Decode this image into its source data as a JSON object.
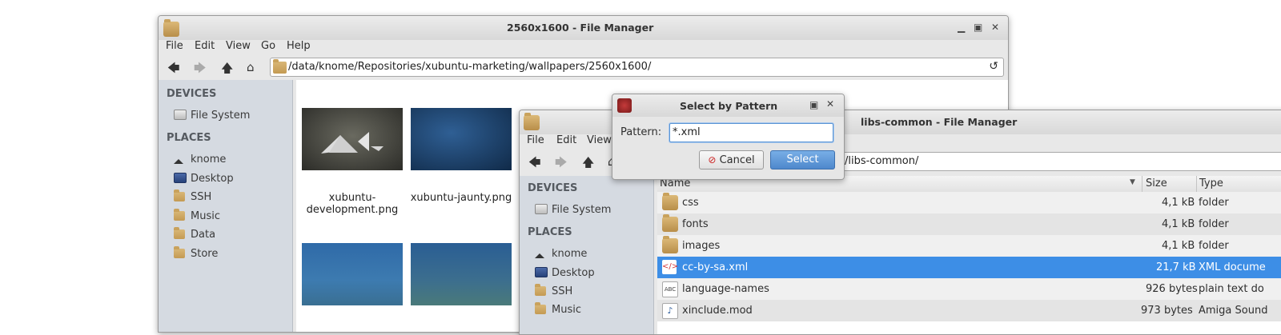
{
  "win1": {
    "title": "2560x1600 - File Manager",
    "menu": [
      "File",
      "Edit",
      "View",
      "Go",
      "Help"
    ],
    "path": "/data/knome/Repositories/xubuntu-marketing/wallpapers/2560x1600/",
    "sidebar": {
      "devices_heading": "DEVICES",
      "devices": [
        {
          "label": "File System",
          "icon": "drive-icon"
        }
      ],
      "places_heading": "PLACES",
      "places": [
        {
          "label": "knome",
          "icon": "home-icon"
        },
        {
          "label": "Desktop",
          "icon": "desktop-icon"
        },
        {
          "label": "SSH",
          "icon": "folder-icon"
        },
        {
          "label": "Music",
          "icon": "folder-icon"
        },
        {
          "label": "Data",
          "icon": "folder-icon"
        },
        {
          "label": "Store",
          "icon": "folder-icon"
        }
      ]
    },
    "files": [
      {
        "line1": "xubuntu-",
        "line2": "development.png"
      },
      {
        "line1": "xubuntu-jaunty.png",
        "line2": ""
      }
    ]
  },
  "win2": {
    "title": "libs-common - File Manager",
    "menu": [
      "File",
      "Edit",
      "View"
    ],
    "path": "/libs-common/",
    "sidebar": {
      "devices_heading": "DEVICES",
      "devices": [
        {
          "label": "File System"
        }
      ],
      "places_heading": "PLACES",
      "places": [
        {
          "label": "knome"
        },
        {
          "label": "Desktop"
        },
        {
          "label": "SSH"
        },
        {
          "label": "Music"
        }
      ]
    },
    "columns": {
      "name": "Name",
      "size": "Size",
      "type": "Type"
    },
    "rows": [
      {
        "name": "css",
        "size": "4,1 kB",
        "type": "folder",
        "icon": "folder-icon"
      },
      {
        "name": "fonts",
        "size": "4,1 kB",
        "type": "folder",
        "icon": "folder-icon"
      },
      {
        "name": "images",
        "size": "4,1 kB",
        "type": "folder",
        "icon": "folder-icon"
      },
      {
        "name": "cc-by-sa.xml",
        "size": "21,7 kB",
        "type": "XML docume",
        "icon": "xml-file-icon",
        "selected": true
      },
      {
        "name": "language-names",
        "size": "926 bytes",
        "type": "plain text do",
        "icon": "text-file-icon"
      },
      {
        "name": "xinclude.mod",
        "size": "973 bytes",
        "type": "Amiga Sound",
        "icon": "audio-file-icon"
      }
    ]
  },
  "dialog": {
    "title": "Select by Pattern",
    "pattern_label": "Pattern:",
    "pattern_value": "*.xml",
    "cancel_label": "Cancel",
    "select_label": "Select"
  },
  "colors": {
    "selection": "#3d8ee6",
    "accent_button": "#5b95d4",
    "sidebar": "#d5dae1"
  }
}
